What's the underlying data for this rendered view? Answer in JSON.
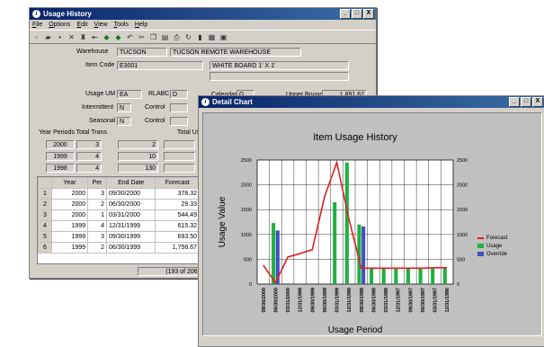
{
  "usage_window": {
    "title": "Usage History",
    "buttons": {
      "minimize": "_",
      "maximize": "□",
      "close": "X"
    },
    "menu": [
      "File",
      "Options",
      "Edit",
      "View",
      "Tools",
      "Help"
    ],
    "toolbar_icons": [
      "new-icon",
      "open-icon",
      "save-icon",
      "delete-icon",
      "find-icon",
      "first-icon",
      "prev-icon",
      "next-icon",
      "undo-icon",
      "cut-icon",
      "copy-icon",
      "paste-icon",
      "preview-icon",
      "refresh-icon",
      "attach-icon",
      "notes-icon",
      "report-icon"
    ],
    "warehouse_label": "Warehouse",
    "warehouse_code": "TUCSON",
    "warehouse_name": "TUCSON REMOTE WAREHOUSE",
    "item_code_label": "Item Code",
    "item_code": "E3001",
    "item_desc": "WHITE BOARD 1' X 1'",
    "usage_um_label": "Usage UM",
    "usage_um": "EA",
    "rlabc_label": "RLABC",
    "rlabc": "D",
    "calendar_label": "Calendar",
    "calendar": "G",
    "upper_bound_label": "Upper Bound",
    "upper_bound": "1,891.62",
    "intermittent_label": "Intermittent",
    "intermittent": "N",
    "control_label": "Control",
    "seasonal_label": "Seasonal",
    "seasonal": "N",
    "control2_label": "Control",
    "year_periods_label": "Year Periods Total Trans",
    "total_label": "Total Us",
    "year_rows": [
      {
        "year": "2000",
        "periods": "3",
        "trans": "2"
      },
      {
        "year": "1999",
        "periods": "4",
        "trans": "10"
      },
      {
        "year": "1998",
        "periods": "4",
        "trans": "130"
      }
    ],
    "grid_headers": [
      "Year",
      "Per",
      "End Date",
      "Forecast"
    ],
    "grid_rows": [
      {
        "n": "1",
        "year": "2000",
        "per": "3",
        "end": "09/30/2000",
        "forecast": "378.32"
      },
      {
        "n": "2",
        "year": "2000",
        "per": "2",
        "end": "06/30/2000",
        "forecast": "29.33"
      },
      {
        "n": "3",
        "year": "2000",
        "per": "1",
        "end": "03/31/2000",
        "forecast": "544.49"
      },
      {
        "n": "4",
        "year": "1999",
        "per": "4",
        "end": "12/31/1999",
        "forecast": "615.32"
      },
      {
        "n": "5",
        "year": "1999",
        "per": "3",
        "end": "09/30/1999",
        "forecast": "693.50"
      },
      {
        "n": "6",
        "year": "1999",
        "per": "2",
        "end": "06/30/1999",
        "forecast": "1,756.67"
      }
    ],
    "status": "(193 of 206)"
  },
  "chart_window": {
    "title": "Detail Chart",
    "buttons": {
      "minimize": "_",
      "maximize": "□",
      "close": "X"
    }
  },
  "chart_data": {
    "type": "bar",
    "title": "Item Usage History",
    "xlabel": "Usage Period",
    "ylabel": "Usage Value",
    "ylim": [
      0,
      2500
    ],
    "yticks": [
      0,
      500,
      1000,
      1500,
      2000,
      2500
    ],
    "grid": true,
    "legend_position": "right",
    "categories": [
      "09/30/2000",
      "06/30/2000",
      "03/31/2000",
      "12/31/1999",
      "09/30/1999",
      "06/30/1999",
      "03/31/1999",
      "12/31/1998",
      "09/30/1998",
      "06/30/1998",
      "03/31/1998",
      "12/31/1997",
      "09/30/1997",
      "06/30/1997",
      "03/31/1997",
      "12/31/1996"
    ],
    "series": [
      {
        "name": "Forecast",
        "kind": "line",
        "color": "#e02020",
        "values": [
          378,
          29,
          544,
          615,
          694,
          1757,
          2450,
          1300,
          320,
          320,
          320,
          320,
          320,
          320,
          330,
          330
        ]
      },
      {
        "name": "Usage",
        "kind": "bar",
        "color": "#20b040",
        "values": [
          0,
          1230,
          0,
          0,
          0,
          0,
          1650,
          2450,
          1200,
          320,
          320,
          320,
          320,
          320,
          330,
          330
        ]
      },
      {
        "name": "Override",
        "kind": "bar",
        "color": "#4050c0",
        "values": [
          0,
          1080,
          0,
          0,
          0,
          0,
          0,
          0,
          1160,
          0,
          0,
          0,
          0,
          0,
          0,
          0
        ]
      }
    ]
  }
}
